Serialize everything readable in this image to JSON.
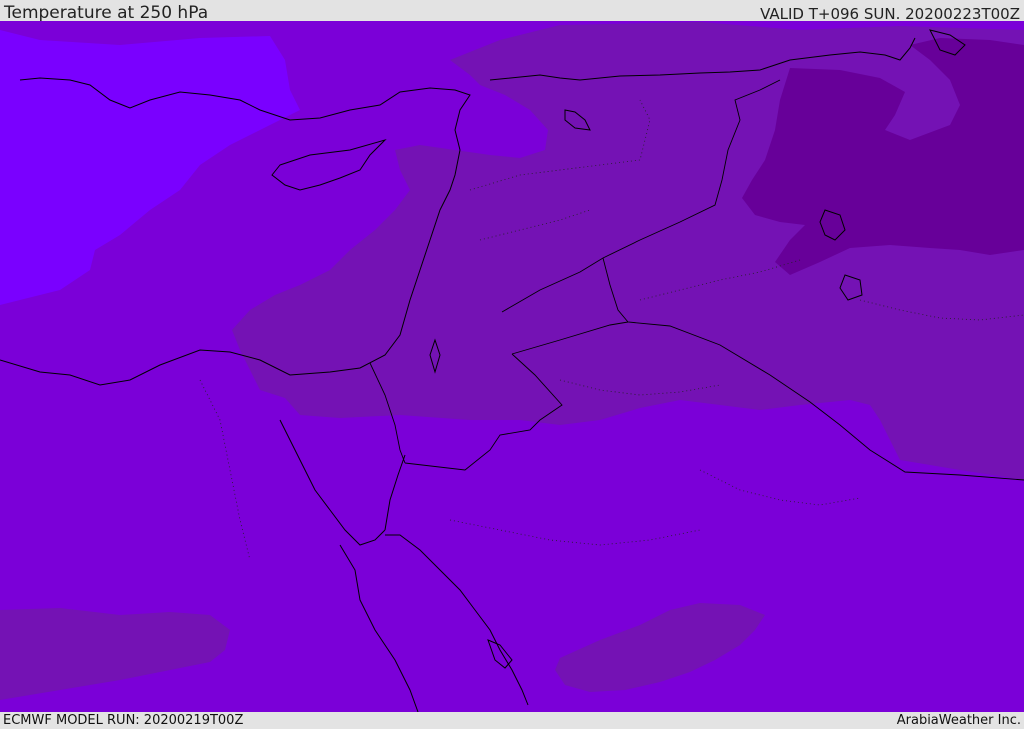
{
  "header": {
    "title": "Temperature at 250 hPa",
    "valid": "VALID T+096 SUN. 20200223T00Z"
  },
  "footer": {
    "model_run": "ECMWF MODEL RUN: 20200219T00Z",
    "credit": "ArabiaWeather Inc."
  },
  "map": {
    "colors": {
      "band_warm": "#7b00d8",
      "band_cool_light": "#7a00ff",
      "band_cold": "#7412b4",
      "band_coldest": "#670099",
      "coastline": "#000000"
    }
  }
}
